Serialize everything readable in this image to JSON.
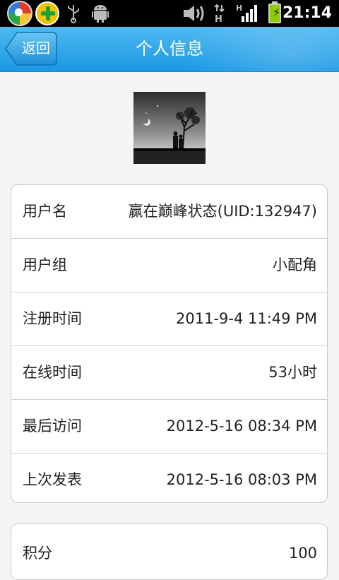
{
  "status_bar": {
    "time": "21:14",
    "network_type": "H",
    "icons": [
      "app-icon",
      "plus-app-icon",
      "usb-icon",
      "android-debug-icon",
      "volume-icon",
      "data-transfer-icon",
      "signal-icon",
      "battery-charging-icon"
    ]
  },
  "header": {
    "back_label": "返回",
    "title": "个人信息"
  },
  "profile": {
    "fields": [
      {
        "label": "用户名",
        "value": "赢在巅峰状态(UID:132947)"
      },
      {
        "label": "用户组",
        "value": "小配角"
      },
      {
        "label": "注册时间",
        "value": "2011-9-4 11:49 PM"
      },
      {
        "label": "在线时间",
        "value": "53小时"
      },
      {
        "label": "最后访问",
        "value": "2012-5-16 08:34 PM"
      },
      {
        "label": "上次发表",
        "value": "2012-5-16 08:03 PM"
      }
    ],
    "stats": [
      {
        "label": "积分",
        "value": "100"
      }
    ]
  },
  "colors": {
    "title_bar": "#1a98e4",
    "background": "#f5f4f7",
    "card_border": "#c9c9cc"
  }
}
